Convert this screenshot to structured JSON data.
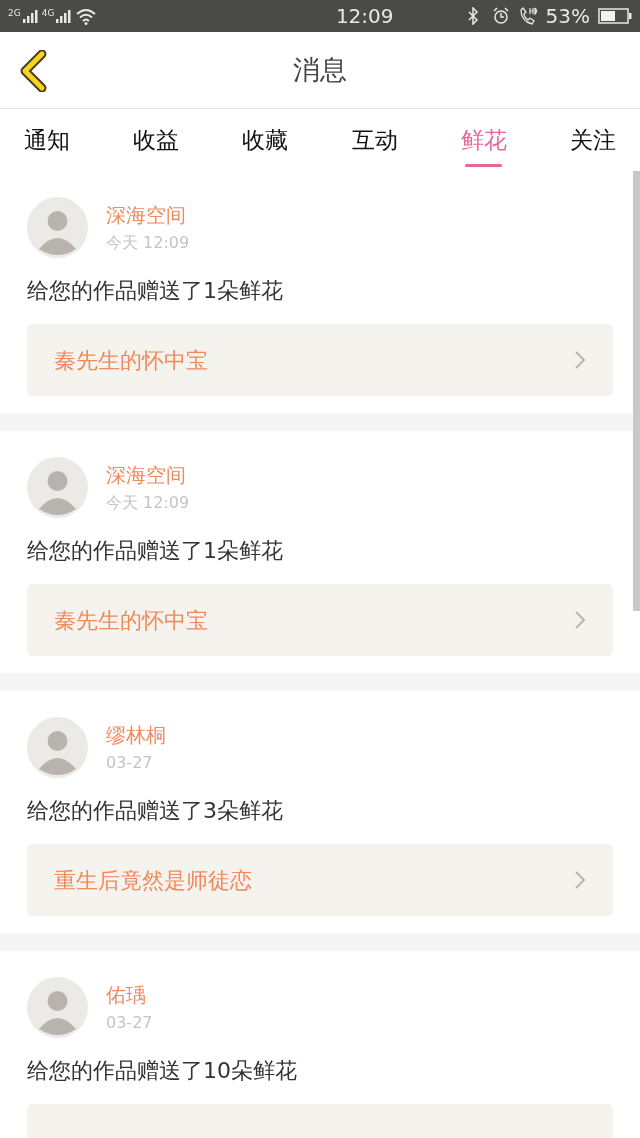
{
  "status_bar": {
    "network_1": "2G",
    "network_2": "4G",
    "time": "12:09",
    "battery": "53%"
  },
  "header": {
    "title": "消息"
  },
  "tabs": [
    {
      "label": "通知",
      "selected": false
    },
    {
      "label": "收益",
      "selected": false
    },
    {
      "label": "收藏",
      "selected": false
    },
    {
      "label": "互动",
      "selected": false
    },
    {
      "label": "鲜花",
      "selected": true
    },
    {
      "label": "关注",
      "selected": false
    }
  ],
  "messages": [
    {
      "name": "深海空间",
      "time": "今天 12:09",
      "text": "给您的作品赠送了1朵鲜花",
      "book_card": true,
      "book": "秦先生的怀中宝"
    },
    {
      "name": "深海空间",
      "time": "今天 12:09",
      "text": "给您的作品赠送了1朵鲜花",
      "book_card": true,
      "book": "秦先生的怀中宝"
    },
    {
      "name": "缪林桐",
      "time": "03-27",
      "text": "给您的作品赠送了3朵鲜花",
      "book_card": true,
      "book": "重生后竟然是师徒恋"
    },
    {
      "name": "佑瑀",
      "time": "03-27",
      "text": "给您的作品赠送了10朵鲜花",
      "book_card": true
    }
  ]
}
